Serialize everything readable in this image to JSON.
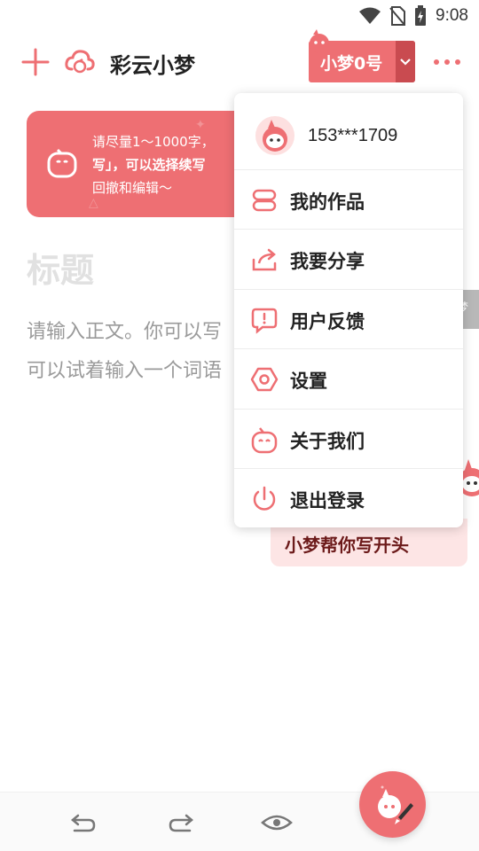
{
  "status_bar": {
    "time": "9:08",
    "icons": [
      "wifi-icon",
      "no-sim-icon",
      "battery-charging-icon"
    ]
  },
  "header": {
    "app_title": "彩云小梦",
    "model_select": {
      "selected": "小梦0号"
    }
  },
  "tip": {
    "text_line1": "请尽量1～1000字，",
    "text_line2": "写」，可以选择续写",
    "text_line3": "回撤和编辑～"
  },
  "editor": {
    "title_placeholder": "标题",
    "body_placeholder_line1": "请输入正文。你可以写",
    "body_placeholder_line2": "可以试着输入一个词语"
  },
  "side_tab": {
    "label": "梦"
  },
  "suggest": {
    "label": "小梦帮你写开头"
  },
  "menu": {
    "user_phone": "153***1709",
    "items": [
      {
        "label": "我的作品",
        "icon": "works-icon"
      },
      {
        "label": "我要分享",
        "icon": "share-icon"
      },
      {
        "label": "用户反馈",
        "icon": "feedback-icon"
      },
      {
        "label": "设置",
        "icon": "settings-icon"
      },
      {
        "label": "关于我们",
        "icon": "about-icon"
      },
      {
        "label": "退出登录",
        "icon": "logout-icon"
      }
    ]
  },
  "colors": {
    "accent": "#ee6f73",
    "accent_dark": "#c94b50",
    "suggest_bg": "#fde5e5"
  }
}
